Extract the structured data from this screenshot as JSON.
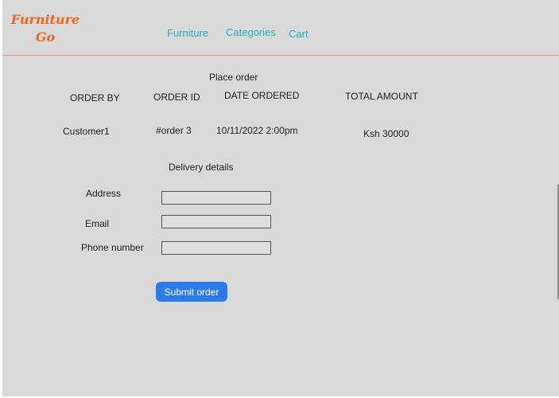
{
  "header": {
    "logo_line1": "Furniture",
    "logo_line2": "Go",
    "nav": {
      "furniture": "Furniture",
      "categories": "Categories",
      "cart": "Cart"
    }
  },
  "order": {
    "title": "Place order",
    "columns": {
      "order_by": "ORDER BY",
      "order_id": "ORDER ID",
      "date_ordered": "DATE ORDERED",
      "total_amount": "TOTAL AMOUNT"
    },
    "row": {
      "order_by": "Customer1",
      "order_id": "#order 3",
      "date_ordered": "10/11/2022 2:00pm",
      "total_amount": "Ksh 30000"
    }
  },
  "delivery": {
    "title": "Delivery details",
    "address_label": "Address",
    "email_label": "Email",
    "phone_label": "Phone number",
    "address_value": "",
    "email_value": "",
    "phone_value": "",
    "submit_label": "Submit order"
  },
  "colors": {
    "background": "#d9d9d9",
    "logo": "#f26522",
    "nav_link": "#1fb5c2",
    "divider": "#f19a7c",
    "primary_button": "#2d7bea"
  }
}
